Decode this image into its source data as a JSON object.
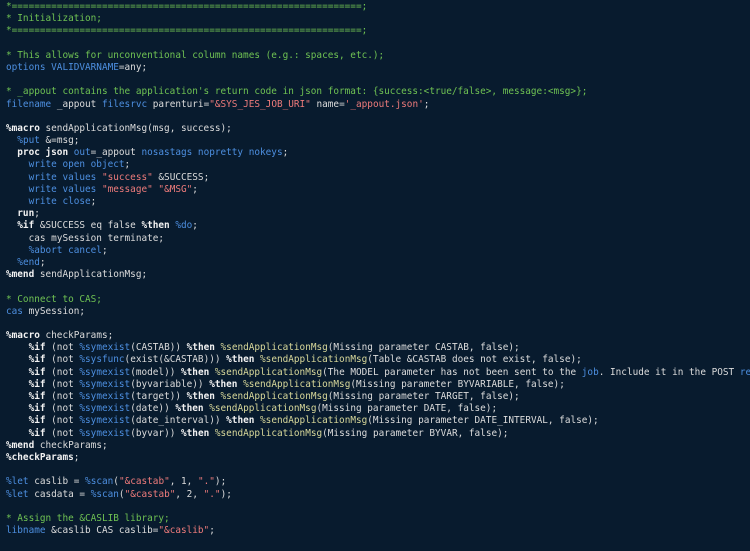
{
  "colors": {
    "background": "#081b2e",
    "comment": "#6fc253",
    "keyword": "#4d8fe0",
    "string": "#ee7b7b",
    "macro_keyword": "#f2f2f2",
    "macro_call": "#d8d89a",
    "plain": "#dcdcdc"
  },
  "lines": [
    [
      {
        "t": "*==============================================================;",
        "c": "c"
      }
    ],
    [
      {
        "t": "* Initialization;",
        "c": "c"
      }
    ],
    [
      {
        "t": "*==============================================================;",
        "c": "c"
      }
    ],
    [],
    [
      {
        "t": "* This allows for unconventional column names (e.g.: spaces, etc.);",
        "c": "c"
      }
    ],
    [
      {
        "t": "options ",
        "c": "k"
      },
      {
        "t": "VALIDVARNAME",
        "c": "k"
      },
      {
        "t": "=any;",
        "c": "p"
      }
    ],
    [],
    [
      {
        "t": "* _appout contains the application's return code in json format: {success:<true/false>, message:<msg>};",
        "c": "c"
      }
    ],
    [
      {
        "t": "filename ",
        "c": "k"
      },
      {
        "t": "_appout ",
        "c": "p"
      },
      {
        "t": "filesrvc ",
        "c": "k"
      },
      {
        "t": "parenturi=",
        "c": "p"
      },
      {
        "t": "\"&SYS_JES_JOB_URI\"",
        "c": "s"
      },
      {
        "t": " name=",
        "c": "p"
      },
      {
        "t": "'_appout.json'",
        "c": "s"
      },
      {
        "t": ";",
        "c": "p"
      }
    ],
    [],
    [
      {
        "t": "%macro ",
        "c": "m"
      },
      {
        "t": "sendApplicationMsg(msg, success);",
        "c": "p"
      }
    ],
    [
      {
        "t": "  ",
        "c": "p"
      },
      {
        "t": "%put ",
        "c": "k"
      },
      {
        "t": "&=msg;",
        "c": "p"
      }
    ],
    [
      {
        "t": "  proc json ",
        "c": "m"
      },
      {
        "t": "out",
        "c": "k"
      },
      {
        "t": "=_appout ",
        "c": "p"
      },
      {
        "t": "nosastags nopretty nokeys",
        "c": "k"
      },
      {
        "t": ";",
        "c": "p"
      }
    ],
    [
      {
        "t": "    write open object",
        "c": "k"
      },
      {
        "t": ";",
        "c": "p"
      }
    ],
    [
      {
        "t": "    write values ",
        "c": "k"
      },
      {
        "t": "\"success\"",
        "c": "s"
      },
      {
        "t": " &SUCCESS;",
        "c": "p"
      }
    ],
    [
      {
        "t": "    write values ",
        "c": "k"
      },
      {
        "t": "\"message\"",
        "c": "s"
      },
      {
        "t": " ",
        "c": "p"
      },
      {
        "t": "\"&MSG\"",
        "c": "s"
      },
      {
        "t": ";",
        "c": "p"
      }
    ],
    [
      {
        "t": "    write close",
        "c": "k"
      },
      {
        "t": ";",
        "c": "p"
      }
    ],
    [
      {
        "t": "  run",
        "c": "m"
      },
      {
        "t": ";",
        "c": "p"
      }
    ],
    [
      {
        "t": "  %if ",
        "c": "m"
      },
      {
        "t": "&SUCCESS eq false ",
        "c": "p"
      },
      {
        "t": "%then ",
        "c": "m"
      },
      {
        "t": "%do",
        "c": "k"
      },
      {
        "t": ";",
        "c": "p"
      }
    ],
    [
      {
        "t": "    cas mySession terminate;",
        "c": "p"
      }
    ],
    [
      {
        "t": "    ",
        "c": "p"
      },
      {
        "t": "%abort cancel",
        "c": "k"
      },
      {
        "t": ";",
        "c": "p"
      }
    ],
    [
      {
        "t": "  ",
        "c": "p"
      },
      {
        "t": "%end",
        "c": "k"
      },
      {
        "t": ";",
        "c": "p"
      }
    ],
    [
      {
        "t": "%mend ",
        "c": "m"
      },
      {
        "t": "sendApplicationMsg;",
        "c": "p"
      }
    ],
    [],
    [
      {
        "t": "* Connect to CAS;",
        "c": "c"
      }
    ],
    [
      {
        "t": "cas ",
        "c": "k"
      },
      {
        "t": "mySession;",
        "c": "p"
      }
    ],
    [],
    [
      {
        "t": "%macro ",
        "c": "m"
      },
      {
        "t": "checkParams;",
        "c": "p"
      }
    ],
    [
      {
        "t": "    %if ",
        "c": "m"
      },
      {
        "t": "(not ",
        "c": "p"
      },
      {
        "t": "%symexist",
        "c": "k"
      },
      {
        "t": "(CASTAB)) ",
        "c": "p"
      },
      {
        "t": "%then ",
        "c": "m"
      },
      {
        "t": "%sendApplicationMsg",
        "c": "f"
      },
      {
        "t": "(Missing parameter CASTAB, false);",
        "c": "p"
      }
    ],
    [
      {
        "t": "    %if ",
        "c": "m"
      },
      {
        "t": "(not ",
        "c": "p"
      },
      {
        "t": "%sysfunc",
        "c": "k"
      },
      {
        "t": "(exist(&CASTAB))) ",
        "c": "p"
      },
      {
        "t": "%then ",
        "c": "m"
      },
      {
        "t": "%sendApplicationMsg",
        "c": "f"
      },
      {
        "t": "(Table &CASTAB does not exist, false);",
        "c": "p"
      }
    ],
    [
      {
        "t": "    %if ",
        "c": "m"
      },
      {
        "t": "(not ",
        "c": "p"
      },
      {
        "t": "%symexist",
        "c": "k"
      },
      {
        "t": "(model)) ",
        "c": "p"
      },
      {
        "t": "%then ",
        "c": "m"
      },
      {
        "t": "%sendApplicationMsg",
        "c": "f"
      },
      {
        "t": "(The MODEL parameter has not been sent to the ",
        "c": "p"
      },
      {
        "t": "job",
        "c": "k"
      },
      {
        "t": ". Include it in the POST ",
        "c": "p"
      },
      {
        "t": "request",
        "c": "k"
      },
      {
        "t": "., false);",
        "c": "p"
      }
    ],
    [
      {
        "t": "    %if ",
        "c": "m"
      },
      {
        "t": "(not ",
        "c": "p"
      },
      {
        "t": "%symexist",
        "c": "k"
      },
      {
        "t": "(byvariable)) ",
        "c": "p"
      },
      {
        "t": "%then ",
        "c": "m"
      },
      {
        "t": "%sendApplicationMsg",
        "c": "f"
      },
      {
        "t": "(Missing parameter BYVARIABLE, false);",
        "c": "p"
      }
    ],
    [
      {
        "t": "    %if ",
        "c": "m"
      },
      {
        "t": "(not ",
        "c": "p"
      },
      {
        "t": "%symexist",
        "c": "k"
      },
      {
        "t": "(target)) ",
        "c": "p"
      },
      {
        "t": "%then ",
        "c": "m"
      },
      {
        "t": "%sendApplicationMsg",
        "c": "f"
      },
      {
        "t": "(Missing parameter TARGET, false);",
        "c": "p"
      }
    ],
    [
      {
        "t": "    %if ",
        "c": "m"
      },
      {
        "t": "(not ",
        "c": "p"
      },
      {
        "t": "%symexist",
        "c": "k"
      },
      {
        "t": "(date)) ",
        "c": "p"
      },
      {
        "t": "%then ",
        "c": "m"
      },
      {
        "t": "%sendApplicationMsg",
        "c": "f"
      },
      {
        "t": "(Missing parameter DATE, false);",
        "c": "p"
      }
    ],
    [
      {
        "t": "    %if ",
        "c": "m"
      },
      {
        "t": "(not ",
        "c": "p"
      },
      {
        "t": "%symexist",
        "c": "k"
      },
      {
        "t": "(date_interval)) ",
        "c": "p"
      },
      {
        "t": "%then ",
        "c": "m"
      },
      {
        "t": "%sendApplicationMsg",
        "c": "f"
      },
      {
        "t": "(Missing parameter DATE_INTERVAL, false);",
        "c": "p"
      }
    ],
    [
      {
        "t": "    %if ",
        "c": "m"
      },
      {
        "t": "(not ",
        "c": "p"
      },
      {
        "t": "%symexist",
        "c": "k"
      },
      {
        "t": "(byvar)) ",
        "c": "p"
      },
      {
        "t": "%then ",
        "c": "m"
      },
      {
        "t": "%sendApplicationMsg",
        "c": "f"
      },
      {
        "t": "(Missing parameter BYVAR, false);",
        "c": "p"
      }
    ],
    [
      {
        "t": "%mend ",
        "c": "m"
      },
      {
        "t": "checkParams;",
        "c": "p"
      }
    ],
    [
      {
        "t": "%checkParams",
        "c": "m"
      },
      {
        "t": ";",
        "c": "p"
      }
    ],
    [],
    [
      {
        "t": "%let ",
        "c": "k"
      },
      {
        "t": "caslib = ",
        "c": "p"
      },
      {
        "t": "%scan",
        "c": "k"
      },
      {
        "t": "(",
        "c": "p"
      },
      {
        "t": "\"&castab\"",
        "c": "s"
      },
      {
        "t": ", 1, ",
        "c": "p"
      },
      {
        "t": "\".\"",
        "c": "s"
      },
      {
        "t": ");",
        "c": "p"
      }
    ],
    [
      {
        "t": "%let ",
        "c": "k"
      },
      {
        "t": "casdata = ",
        "c": "p"
      },
      {
        "t": "%scan",
        "c": "k"
      },
      {
        "t": "(",
        "c": "p"
      },
      {
        "t": "\"&castab\"",
        "c": "s"
      },
      {
        "t": ", 2, ",
        "c": "p"
      },
      {
        "t": "\".\"",
        "c": "s"
      },
      {
        "t": ");",
        "c": "p"
      }
    ],
    [],
    [
      {
        "t": "* Assign the &CASLIB library;",
        "c": "c"
      }
    ],
    [
      {
        "t": "libname ",
        "c": "k"
      },
      {
        "t": "&caslib CAS caslib=",
        "c": "p"
      },
      {
        "t": "\"&caslib\"",
        "c": "s"
      },
      {
        "t": ";",
        "c": "p"
      }
    ]
  ]
}
